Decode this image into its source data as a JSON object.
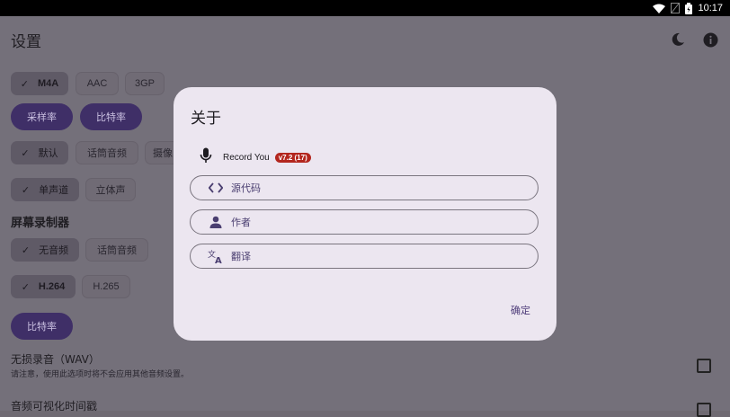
{
  "status_bar": {
    "time": "10:17"
  },
  "app": {
    "title": "设置",
    "format_chips": [
      {
        "label": "M4A",
        "selected": true
      },
      {
        "label": "AAC",
        "selected": false
      },
      {
        "label": "3GP",
        "selected": false
      }
    ],
    "audio_buttons": [
      "采样率",
      "比特率"
    ],
    "source_chips": [
      {
        "label": "默认",
        "selected": true
      },
      {
        "label": "话筒音频",
        "selected": false
      },
      {
        "label": "摄像",
        "selected": false
      }
    ],
    "channel_chips": [
      {
        "label": "单声道",
        "selected": true
      },
      {
        "label": "立体声",
        "selected": false
      }
    ],
    "screen_recorder_title": "屏幕录制器",
    "screen_audio_chips": [
      {
        "label": "无音频",
        "selected": true
      },
      {
        "label": "话筒音频",
        "selected": false
      }
    ],
    "codec_chips": [
      {
        "label": "H.264",
        "selected": true
      },
      {
        "label": "H.265",
        "selected": false
      }
    ],
    "screen_bitrate_button": "比特率",
    "lossless_title": "无损录音（WAV）",
    "lossless_subtitle": "请注意，使用此选项时将不会应用其他音频设置。",
    "visualizer_title": "音频可视化时间戳"
  },
  "dialog": {
    "title": "关于",
    "app_name": "Record You",
    "version_badge": "v7.2 (17)",
    "links": [
      {
        "label": "源代码",
        "icon": "code-icon"
      },
      {
        "label": "作者",
        "icon": "person-icon"
      },
      {
        "label": "翻译",
        "icon": "translate-icon"
      }
    ],
    "confirm_label": "确定"
  }
}
